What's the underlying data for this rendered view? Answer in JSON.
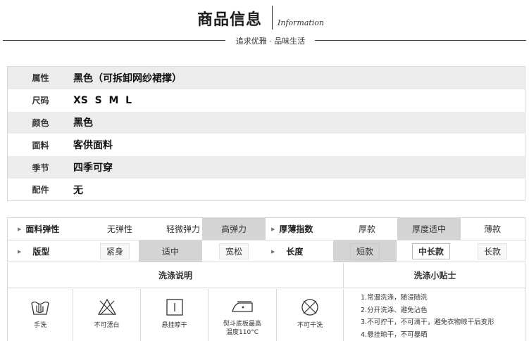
{
  "header": {
    "title": "商品信息",
    "title_en": "Information",
    "subtitle": "追求优雅 · 品味生活"
  },
  "attributes": [
    {
      "key": "属性",
      "value": "黑色（可拆卸网纱裙撑）"
    },
    {
      "key": "尺码",
      "value": "XS  S  M  L"
    },
    {
      "key": "颜色",
      "value": "黑色"
    },
    {
      "key": "面料",
      "value": "客供面料"
    },
    {
      "key": "季节",
      "value": "四季可穿"
    },
    {
      "key": "配件",
      "value": "无"
    }
  ],
  "properties": {
    "elasticity": {
      "label": "面料弹性",
      "options": [
        "无弹性",
        "轻微弹力",
        "高弹力"
      ],
      "selected": "高弹力"
    },
    "thickness": {
      "label": "厚薄指数",
      "options": [
        "厚款",
        "厚度适中",
        "薄款"
      ],
      "selected": "厚度适中"
    },
    "fit": {
      "label": "版型",
      "options": [
        "紧身",
        "适中",
        "宽松"
      ],
      "selected": "适中"
    },
    "length": {
      "label": "长度",
      "options": [
        "短款",
        "中长款",
        "长款"
      ],
      "selected": "中长款"
    }
  },
  "care": {
    "instructions_title": "洗涤说明",
    "tips_title": "洗涤小贴士",
    "icons": [
      {
        "icon": "hand-wash-icon",
        "caption": "手洗"
      },
      {
        "icon": "no-bleach-icon",
        "caption": "不可漂白"
      },
      {
        "icon": "hang-dry-icon",
        "caption": "悬挂晾干"
      },
      {
        "icon": "iron-icon",
        "caption": "熨斗底板最高温度110°C"
      },
      {
        "icon": "no-tumble-dry-icon",
        "caption": "不可干洗"
      }
    ],
    "iron_caption_lines": [
      "熨斗底板最高",
      "温度110°C"
    ],
    "tips": [
      "1.常温洗涤，随浸随洗",
      "2.分开洗涤、避免沾色",
      "3.不可拧干，不可滴干，避免衣物晾干后变形",
      "4.悬挂晾干，不可暴晒"
    ]
  }
}
